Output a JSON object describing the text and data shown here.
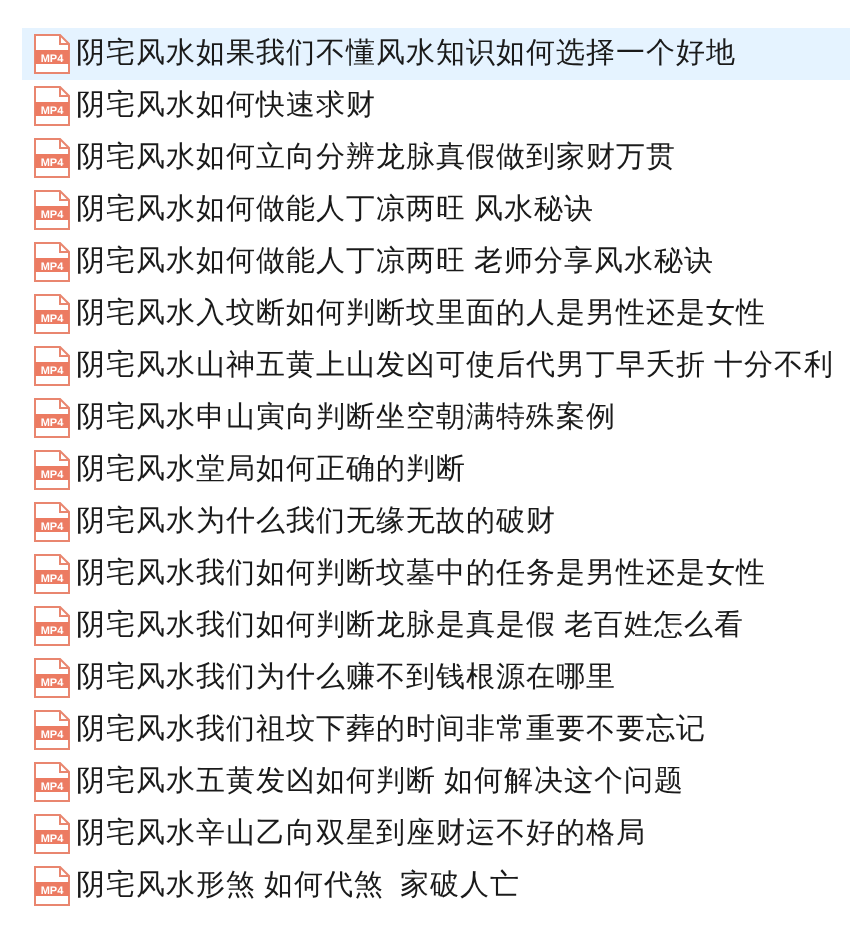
{
  "files": [
    {
      "name": "阴宅风水如果我们不懂风水知识如何选择一个好地",
      "type": "MP4",
      "selected": true
    },
    {
      "name": "阴宅风水如何快速求财",
      "type": "MP4",
      "selected": false
    },
    {
      "name": "阴宅风水如何立向分辨龙脉真假做到家财万贯",
      "type": "MP4",
      "selected": false
    },
    {
      "name": "阴宅风水如何做能人丁凉两旺 风水秘诀",
      "type": "MP4",
      "selected": false
    },
    {
      "name": "阴宅风水如何做能人丁凉两旺 老师分享风水秘诀",
      "type": "MP4",
      "selected": false
    },
    {
      "name": "阴宅风水入坟断如何判断坟里面的人是男性还是女性",
      "type": "MP4",
      "selected": false
    },
    {
      "name": "阴宅风水山神五黄上山发凶可使后代男丁早夭折 十分不利",
      "type": "MP4",
      "selected": false
    },
    {
      "name": "阴宅风水申山寅向判断坐空朝满特殊案例",
      "type": "MP4",
      "selected": false
    },
    {
      "name": "阴宅风水堂局如何正确的判断",
      "type": "MP4",
      "selected": false
    },
    {
      "name": "阴宅风水为什么我们无缘无故的破财",
      "type": "MP4",
      "selected": false
    },
    {
      "name": "阴宅风水我们如何判断坟墓中的任务是男性还是女性",
      "type": "MP4",
      "selected": false
    },
    {
      "name": "阴宅风水我们如何判断龙脉是真是假 老百姓怎么看",
      "type": "MP4",
      "selected": false
    },
    {
      "name": "阴宅风水我们为什么赚不到钱根源在哪里",
      "type": "MP4",
      "selected": false
    },
    {
      "name": "阴宅风水我们祖坟下葬的时间非常重要不要忘记",
      "type": "MP4",
      "selected": false
    },
    {
      "name": "阴宅风水五黄发凶如何判断 如何解决这个问题",
      "type": "MP4",
      "selected": false
    },
    {
      "name": "阴宅风水辛山乙向双星到座财运不好的格局",
      "type": "MP4",
      "selected": false
    },
    {
      "name": "阴宅风水形煞 如何代煞  家破人亡",
      "type": "MP4",
      "selected": false
    }
  ]
}
